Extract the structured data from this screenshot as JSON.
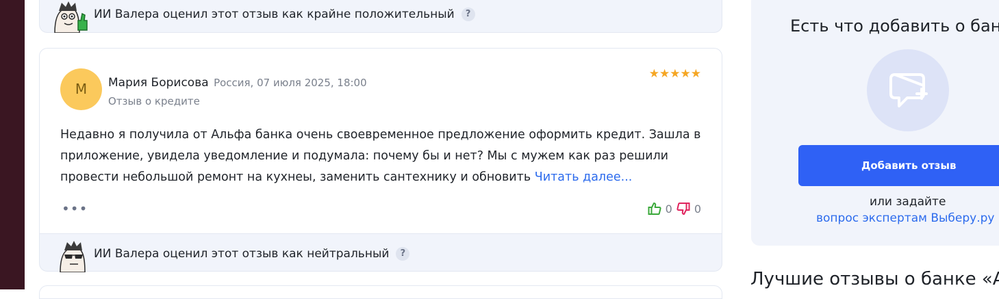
{
  "ai_verdict_top": {
    "text": "ИИ Валера оценил этот отзыв как крайне положительный",
    "help": "?"
  },
  "review": {
    "avatar_letter": "М",
    "author": "Мария Борисова",
    "meta": "Россия, 07 июля 2025, 18:00",
    "subject": "Отзыв о кредите",
    "rating": 5,
    "stars": "★★★★★",
    "text": "Недавно я получила от Альфа банка очень своевременное предложение оформить кредит. Зашла в приложение, увидела уведомление и подумала: почему бы и нет? Мы с мужем как раз решили провести небольшой ремонт на кухнеы, заменить сантехнику и обновить ",
    "read_more": "Читать далее...",
    "more": "•••",
    "likes": "0",
    "dislikes": "0"
  },
  "ai_verdict_bottom": {
    "text": "ИИ Валера оценил этот отзыв как нейтральный",
    "help": "?"
  },
  "sidebar": {
    "title": "Есть что добавить о бан",
    "add_button": "Добавить отзыв",
    "or_ask": "или задайте",
    "experts_link": "вопрос экспертам Выберу.ру"
  },
  "best_reviews_title": "Лучшие отзывы о банке «А",
  "colors": {
    "accent": "#2f61f5",
    "star": "#f5a623",
    "like": "#3aa83a",
    "dislike": "#e0245e",
    "avatar": "#fbc95c"
  },
  "icons": {
    "mascot_top": "mascot-thumbs-up-icon",
    "mascot_bottom": "mascot-sunglasses-icon",
    "add_review": "chat-plus-icon",
    "like": "thumbs-up-icon",
    "dislike": "thumbs-down-icon"
  }
}
